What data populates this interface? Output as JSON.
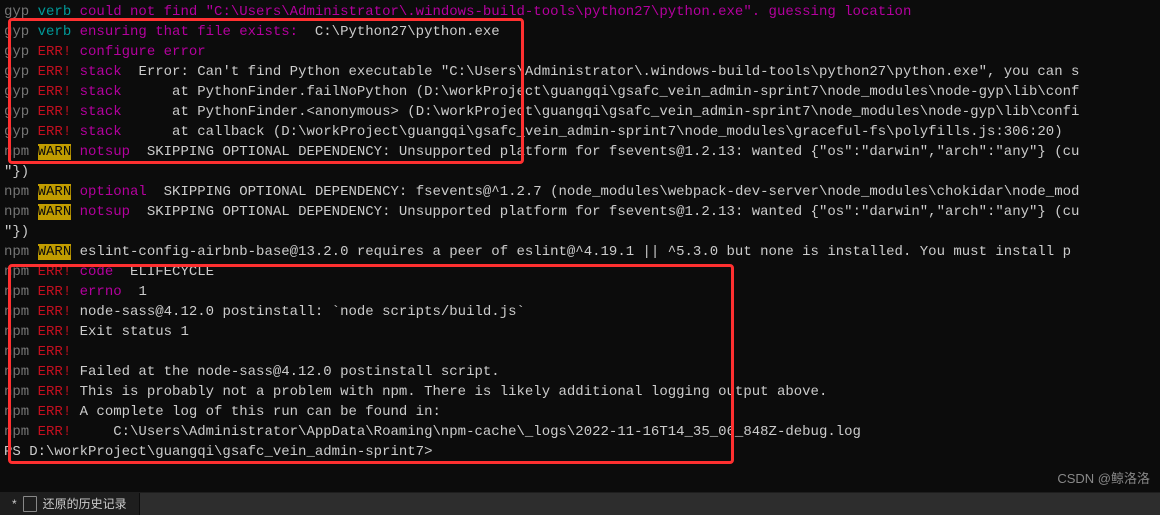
{
  "lines": [
    {
      "prefix": "gyp",
      "kind": "verb",
      "tag": "",
      "text": "could not find \"C:\\Users\\Administrator\\.windows-build-tools\\python27\\python.exe\". guessing location",
      "textClass": "purple"
    },
    {
      "prefix": "gyp",
      "kind": "verb",
      "tag": "ensuring that file exists:",
      "text": " C:\\Python27\\python.exe",
      "textClass": "white",
      "tagClass": "purple"
    },
    {
      "prefix": "gyp",
      "kind": "err",
      "tag": "configure error",
      "text": "",
      "textClass": "white",
      "tagClass": "purple"
    },
    {
      "prefix": "gyp",
      "kind": "err",
      "tag": "stack",
      "text": " Error: Can't find Python executable \"C:\\Users\\Administrator\\.windows-build-tools\\python27\\python.exe\", you can s",
      "textClass": "white",
      "tagClass": "purple"
    },
    {
      "prefix": "gyp",
      "kind": "err",
      "tag": "stack",
      "text": "     at PythonFinder.failNoPython (D:\\workProject\\guangqi\\gsafc_vein_admin-sprint7\\node_modules\\node-gyp\\lib\\conf",
      "textClass": "white",
      "tagClass": "purple"
    },
    {
      "prefix": "gyp",
      "kind": "err",
      "tag": "stack",
      "text": "     at PythonFinder.<anonymous> (D:\\workProject\\guangqi\\gsafc_vein_admin-sprint7\\node_modules\\node-gyp\\lib\\confi",
      "textClass": "white",
      "tagClass": "purple"
    },
    {
      "prefix": "gyp",
      "kind": "err",
      "tag": "stack",
      "text": "     at callback (D:\\workProject\\guangqi\\gsafc_vein_admin-sprint7\\node_modules\\graceful-fs\\polyfills.js:306:20)",
      "textClass": "white",
      "tagClass": "purple"
    },
    {
      "prefix": "npm",
      "kind": "warn",
      "tag": "notsup",
      "text": " SKIPPING OPTIONAL DEPENDENCY: Unsupported platform for fsevents@1.2.13: wanted {\"os\":\"darwin\",\"arch\":\"any\"} (cu",
      "textClass": "white",
      "tagClass": "purple"
    },
    {
      "prefix": "",
      "kind": "plain",
      "tag": "",
      "text": "\"})",
      "textClass": "white"
    },
    {
      "prefix": "npm",
      "kind": "warn",
      "tag": "optional",
      "text": " SKIPPING OPTIONAL DEPENDENCY: fsevents@^1.2.7 (node_modules\\webpack-dev-server\\node_modules\\chokidar\\node_mod",
      "textClass": "white",
      "tagClass": "purple"
    },
    {
      "prefix": "npm",
      "kind": "warn",
      "tag": "notsup",
      "text": " SKIPPING OPTIONAL DEPENDENCY: Unsupported platform for fsevents@1.2.13: wanted {\"os\":\"darwin\",\"arch\":\"any\"} (cu",
      "textClass": "white",
      "tagClass": "purple"
    },
    {
      "prefix": "",
      "kind": "plain",
      "tag": "",
      "text": "\"})",
      "textClass": "white"
    },
    {
      "prefix": "npm",
      "kind": "warn",
      "tag": "",
      "text": "eslint-config-airbnb-base@13.2.0 requires a peer of eslint@^4.19.1 || ^5.3.0 but none is installed. You must install p",
      "textClass": "white"
    },
    {
      "prefix": "",
      "kind": "plain",
      "tag": "",
      "text": "",
      "textClass": "white"
    },
    {
      "prefix": "npm",
      "kind": "err",
      "tag": "code",
      "text": " ELIFECYCLE",
      "textClass": "white",
      "tagClass": "purple"
    },
    {
      "prefix": "npm",
      "kind": "err",
      "tag": "errno",
      "text": " 1",
      "textClass": "white",
      "tagClass": "purple"
    },
    {
      "prefix": "npm",
      "kind": "err",
      "tag": "",
      "text": "node-sass@4.12.0 postinstall: `node scripts/build.js`",
      "textClass": "white"
    },
    {
      "prefix": "npm",
      "kind": "err",
      "tag": "",
      "text": "Exit status 1",
      "textClass": "white"
    },
    {
      "prefix": "npm",
      "kind": "err",
      "tag": "",
      "text": "",
      "textClass": "white"
    },
    {
      "prefix": "npm",
      "kind": "err",
      "tag": "",
      "text": "Failed at the node-sass@4.12.0 postinstall script.",
      "textClass": "white"
    },
    {
      "prefix": "npm",
      "kind": "err",
      "tag": "",
      "text": "This is probably not a problem with npm. There is likely additional logging output above.",
      "textClass": "white"
    },
    {
      "prefix": "",
      "kind": "plain",
      "tag": "",
      "text": "",
      "textClass": "white"
    },
    {
      "prefix": "npm",
      "kind": "err",
      "tag": "",
      "text": "A complete log of this run can be found in:",
      "textClass": "white"
    },
    {
      "prefix": "npm",
      "kind": "err",
      "tag": "",
      "text": "    C:\\Users\\Administrator\\AppData\\Roaming\\npm-cache\\_logs\\2022-11-16T14_35_06_848Z-debug.log",
      "textClass": "white"
    }
  ],
  "prompt": "PS D:\\workProject\\guangqi\\gsafc_vein_admin-sprint7>",
  "tab": {
    "label": "还原的历史记录",
    "modified": "*"
  },
  "watermark": "CSDN @鲸洛洛"
}
